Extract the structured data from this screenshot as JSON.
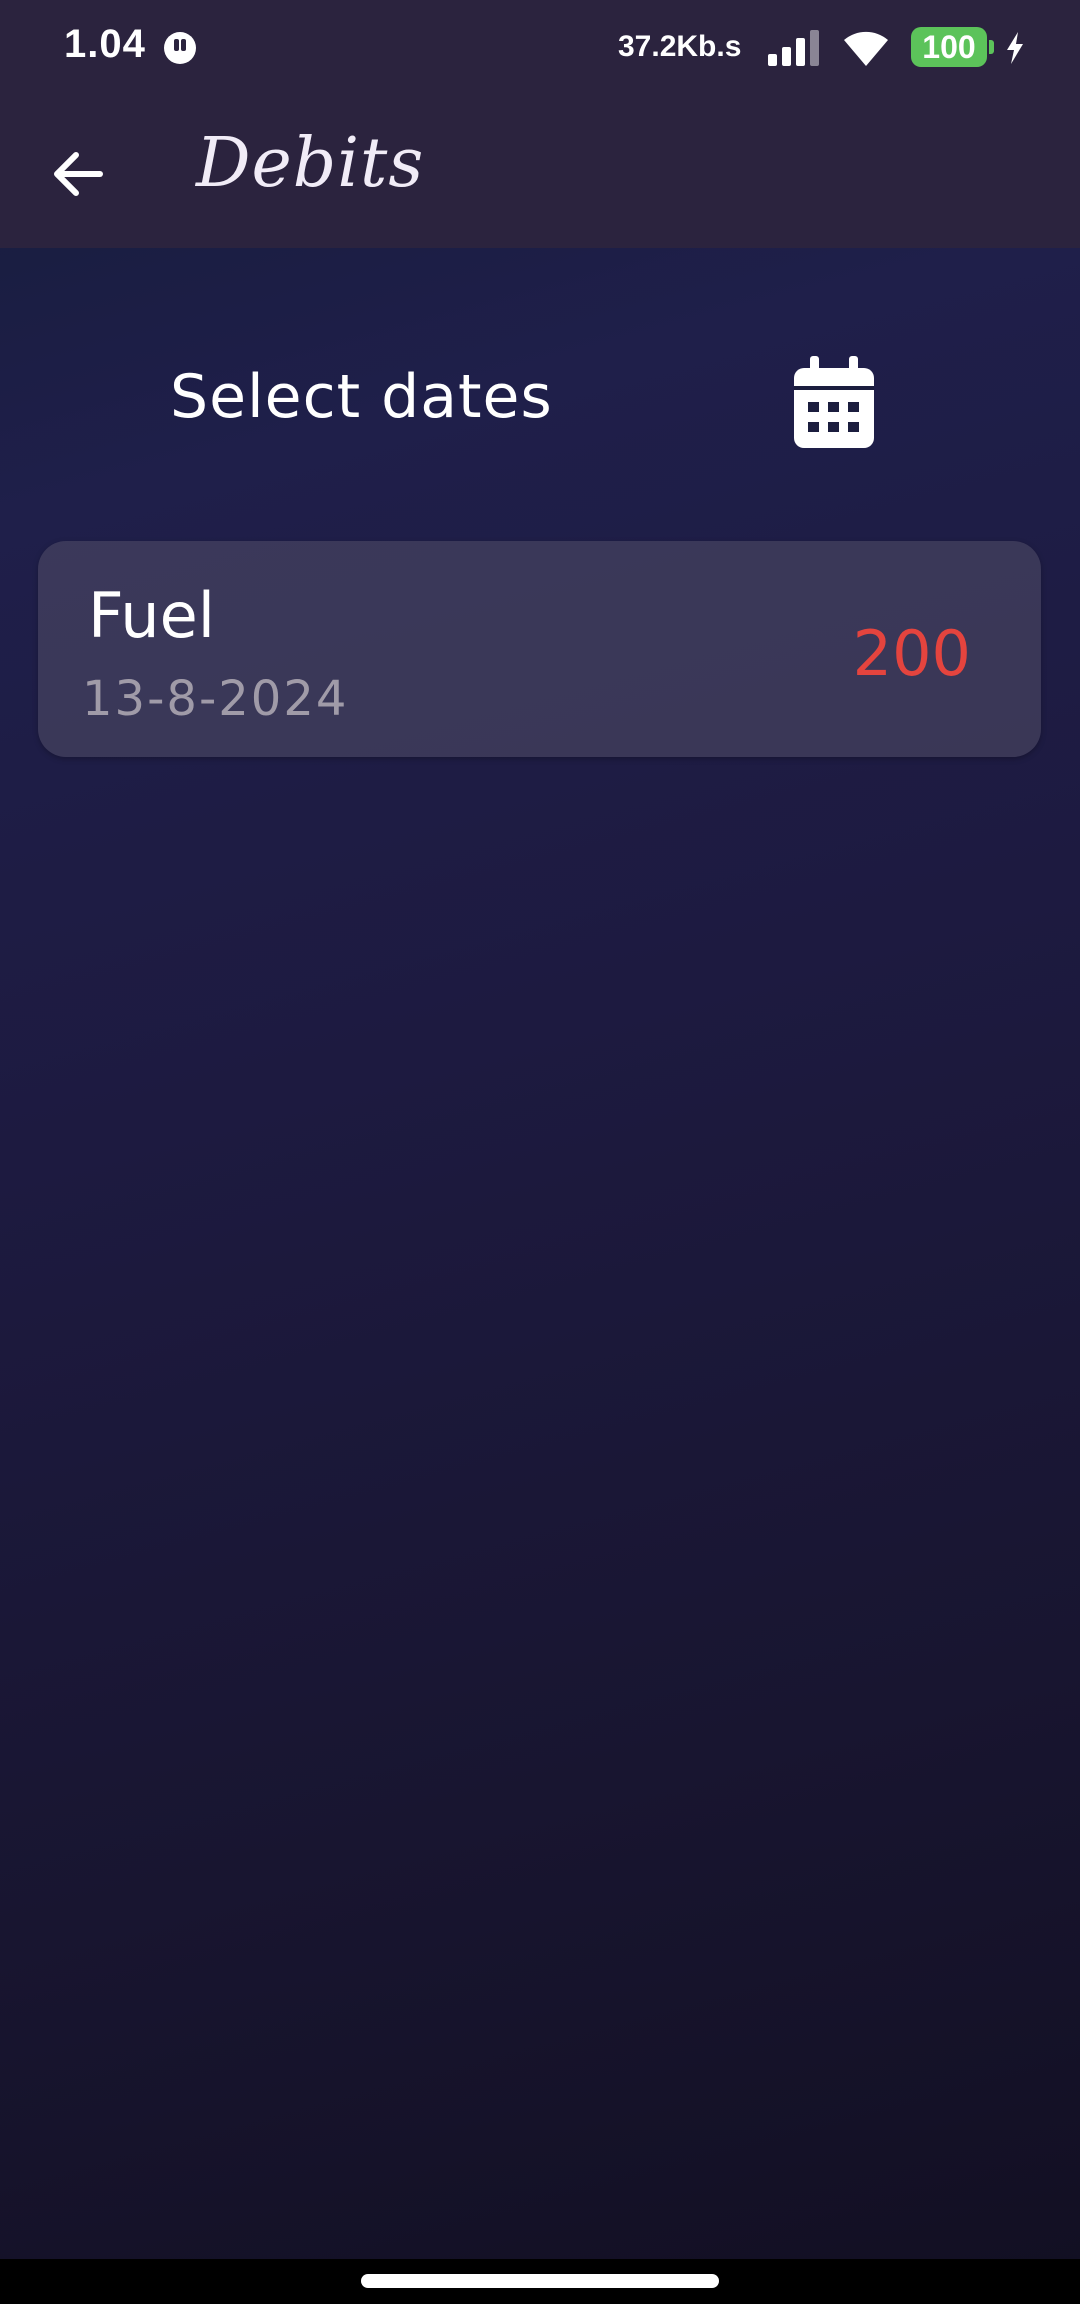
{
  "status_bar": {
    "time": "1.04",
    "network_speed": "37.2Kb.s",
    "battery_level": "100",
    "battery_color": "#5cc35a",
    "icons": [
      "app-notification-icon",
      "signal-icon",
      "wifi-icon",
      "charging-icon"
    ]
  },
  "app_bar": {
    "title": "Debits",
    "back_icon": "arrow-left-icon"
  },
  "filter": {
    "label": "Select dates",
    "icon": "calendar-icon"
  },
  "transactions": [
    {
      "title": "Fuel",
      "date": "13-8-2024",
      "amount": "200",
      "amount_color": "#e4443e"
    }
  ]
}
